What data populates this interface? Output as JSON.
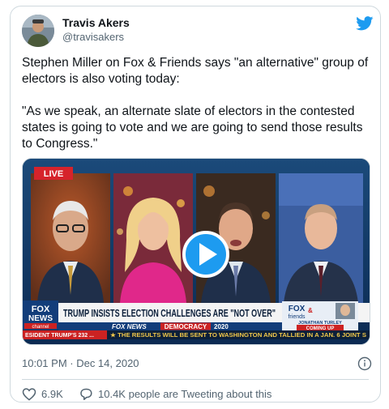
{
  "author": {
    "display_name": "Travis Akers",
    "handle": "@travisakers"
  },
  "tweet": {
    "paragraphs": [
      "Stephen Miller on Fox & Friends says \"an alternative\" group of electors is also voting today:",
      "\"As we speak, an alternate slate of electors in the contested states is going to vote and we are going to send those results to Congress.\""
    ],
    "timestamp": "10:01 PM · Dec 14, 2020"
  },
  "video": {
    "live_label": "LIVE",
    "network_logo_top": "FOX",
    "network_logo_bottom": "NEWS",
    "network_logo_channel": "channel",
    "headline": "TRUMP INSISTS ELECTION CHALLENGES ARE \"NOT OVER\"",
    "subbar_network": "FOX NEWS",
    "subbar_tag": "DEMOCRACY",
    "subbar_year": "2020",
    "ticker_left": "ESIDENT TRUMP'S 232 ...",
    "ticker_text": "★ THE RESULTS WILL BE SENT TO WASHINGTON AND TALLIED IN A JAN. 6 JOINT S",
    "show_logo_top": "FOX",
    "show_logo_amp": "&",
    "show_logo_bottom": "friends",
    "upcoming_name": "JONATHAN TURLEY",
    "upcoming_label": "COMING UP"
  },
  "actions": {
    "likes": "6.9K",
    "tweeting": "10.4K people are Tweeting about this"
  },
  "colors": {
    "twitter_blue": "#1d9bf0",
    "secondary_text": "#536471",
    "border": "#cfd9de",
    "live_red": "#d6232b"
  },
  "icons": [
    "twitter-bird-icon",
    "play-icon",
    "info-icon",
    "heart-icon",
    "speech-bubble-icon"
  ]
}
